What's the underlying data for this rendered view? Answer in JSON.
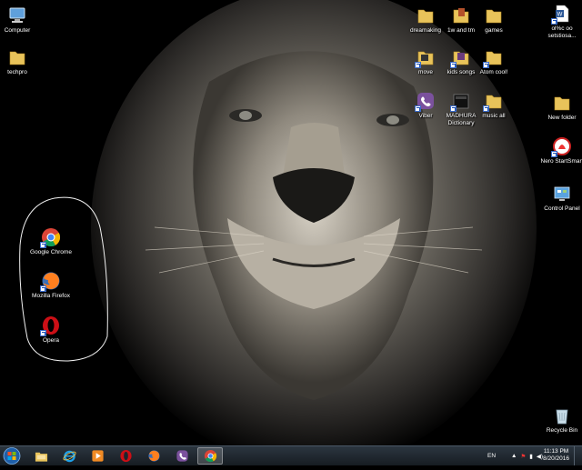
{
  "desktop": {
    "icons": [
      {
        "id": "computer",
        "label": "Computer",
        "icon": "computer-icon"
      },
      {
        "id": "techpro",
        "label": "techpro",
        "icon": "folder-icon"
      },
      {
        "id": "dreammaking",
        "label": "dreamaking",
        "icon": "folder-icon"
      },
      {
        "id": "1w-and-tm",
        "label": "1w and tm",
        "icon": "folder-icon"
      },
      {
        "id": "games",
        "label": "games",
        "icon": "folder-icon"
      },
      {
        "id": "word-doc",
        "label": "ol%c oo setstiosa...",
        "icon": "word-doc-icon"
      },
      {
        "id": "move",
        "label": "move",
        "icon": "folder-icon"
      },
      {
        "id": "kids-songs",
        "label": "kids songs",
        "icon": "folder-icon"
      },
      {
        "id": "atom-cool",
        "label": "Atom cool!",
        "icon": "folder-icon"
      },
      {
        "id": "viber",
        "label": "Viber",
        "icon": "viber-icon"
      },
      {
        "id": "madhura",
        "label": "MADHURA Dictionary",
        "icon": "dictionary-icon"
      },
      {
        "id": "music-all",
        "label": "music all",
        "icon": "folder-icon"
      },
      {
        "id": "new-folder",
        "label": "New folder",
        "icon": "folder-icon"
      },
      {
        "id": "nero",
        "label": "Nero StartSmart",
        "icon": "nero-icon"
      },
      {
        "id": "control-panel",
        "label": "Control Panel",
        "icon": "control-panel-icon"
      },
      {
        "id": "chrome",
        "label": "Google Chrome",
        "icon": "chrome-icon"
      },
      {
        "id": "firefox",
        "label": "Mozilla Firefox",
        "icon": "firefox-icon"
      },
      {
        "id": "opera",
        "label": "Opera",
        "icon": "opera-icon"
      },
      {
        "id": "recycle-bin",
        "label": "Recycle Bin",
        "icon": "recycle-bin-icon"
      }
    ]
  },
  "taskbar": {
    "pinned": [
      "explorer-icon",
      "ie-icon",
      "media-player-icon",
      "opera-icon",
      "firefox-icon",
      "viber-icon",
      "chrome-icon"
    ],
    "active": "chrome-icon",
    "language": "EN",
    "time": "11:13 PM",
    "date": "8/20/2016"
  },
  "colors": {
    "folder": "#e8c35a",
    "taskbar": "#1d252d",
    "chrome_red": "#db4437",
    "chrome_green": "#0f9d58",
    "chrome_yellow": "#f4b400",
    "chrome_blue": "#4285f4",
    "opera_red": "#cc0f16",
    "firefox_orange": "#ff7f1f",
    "viber_purple": "#7b519d"
  }
}
